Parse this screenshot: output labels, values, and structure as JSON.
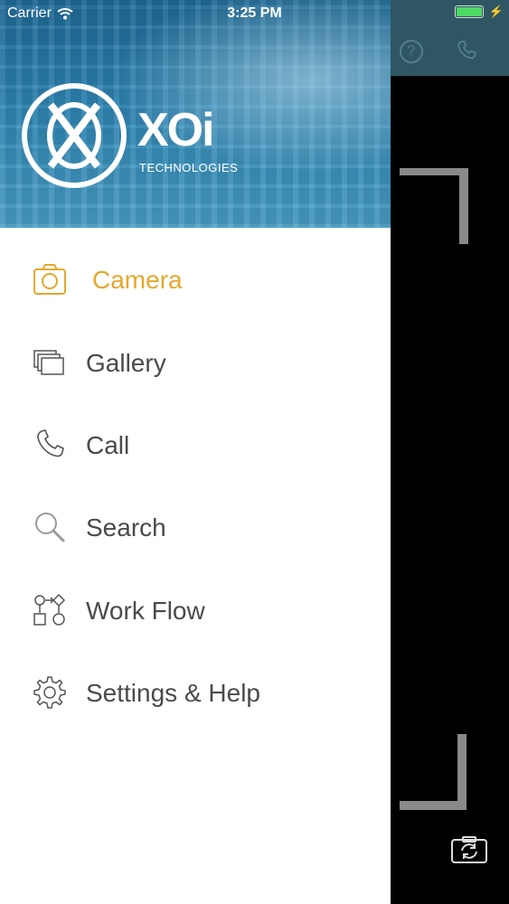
{
  "status_bar": {
    "carrier": "Carrier",
    "time": "3:25 PM"
  },
  "logo": {
    "brand": "XOi",
    "tagline": "TECHNOLOGIES"
  },
  "menu": {
    "items": [
      {
        "label": "Camera",
        "icon": "camera-icon",
        "active": true
      },
      {
        "label": "Gallery",
        "icon": "gallery-icon",
        "active": false
      },
      {
        "label": "Call",
        "icon": "phone-icon",
        "active": false
      },
      {
        "label": "Search",
        "icon": "search-icon",
        "active": false
      },
      {
        "label": "Work Flow",
        "icon": "workflow-icon",
        "active": false
      },
      {
        "label": "Settings & Help",
        "icon": "gear-icon",
        "active": false
      }
    ]
  },
  "camera_panel": {
    "icons": [
      "help-icon",
      "phone-icon",
      "switch-camera-icon"
    ]
  },
  "colors": {
    "active": "#e5a82c",
    "text": "#4a4a4a",
    "topbar": "#2f5663"
  }
}
